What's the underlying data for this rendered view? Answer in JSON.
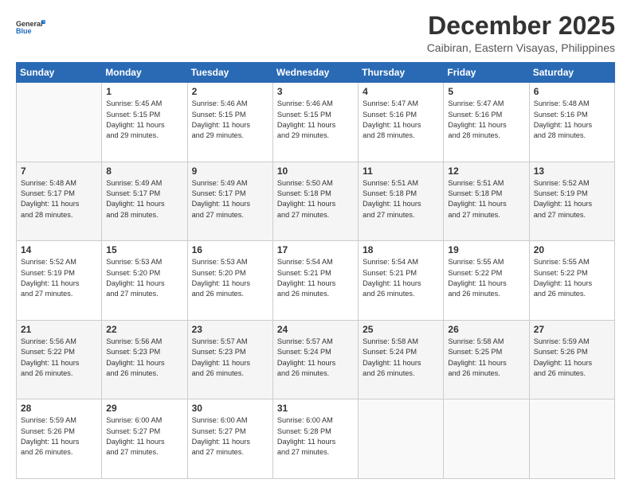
{
  "logo": {
    "line1": "General",
    "line2": "Blue"
  },
  "title": "December 2025",
  "subtitle": "Caibiran, Eastern Visayas, Philippines",
  "weekdays": [
    "Sunday",
    "Monday",
    "Tuesday",
    "Wednesday",
    "Thursday",
    "Friday",
    "Saturday"
  ],
  "weeks": [
    [
      {
        "day": "",
        "info": ""
      },
      {
        "day": "1",
        "info": "Sunrise: 5:45 AM\nSunset: 5:15 PM\nDaylight: 11 hours\nand 29 minutes."
      },
      {
        "day": "2",
        "info": "Sunrise: 5:46 AM\nSunset: 5:15 PM\nDaylight: 11 hours\nand 29 minutes."
      },
      {
        "day": "3",
        "info": "Sunrise: 5:46 AM\nSunset: 5:15 PM\nDaylight: 11 hours\nand 29 minutes."
      },
      {
        "day": "4",
        "info": "Sunrise: 5:47 AM\nSunset: 5:16 PM\nDaylight: 11 hours\nand 28 minutes."
      },
      {
        "day": "5",
        "info": "Sunrise: 5:47 AM\nSunset: 5:16 PM\nDaylight: 11 hours\nand 28 minutes."
      },
      {
        "day": "6",
        "info": "Sunrise: 5:48 AM\nSunset: 5:16 PM\nDaylight: 11 hours\nand 28 minutes."
      }
    ],
    [
      {
        "day": "7",
        "info": "Sunrise: 5:48 AM\nSunset: 5:17 PM\nDaylight: 11 hours\nand 28 minutes."
      },
      {
        "day": "8",
        "info": "Sunrise: 5:49 AM\nSunset: 5:17 PM\nDaylight: 11 hours\nand 28 minutes."
      },
      {
        "day": "9",
        "info": "Sunrise: 5:49 AM\nSunset: 5:17 PM\nDaylight: 11 hours\nand 27 minutes."
      },
      {
        "day": "10",
        "info": "Sunrise: 5:50 AM\nSunset: 5:18 PM\nDaylight: 11 hours\nand 27 minutes."
      },
      {
        "day": "11",
        "info": "Sunrise: 5:51 AM\nSunset: 5:18 PM\nDaylight: 11 hours\nand 27 minutes."
      },
      {
        "day": "12",
        "info": "Sunrise: 5:51 AM\nSunset: 5:18 PM\nDaylight: 11 hours\nand 27 minutes."
      },
      {
        "day": "13",
        "info": "Sunrise: 5:52 AM\nSunset: 5:19 PM\nDaylight: 11 hours\nand 27 minutes."
      }
    ],
    [
      {
        "day": "14",
        "info": "Sunrise: 5:52 AM\nSunset: 5:19 PM\nDaylight: 11 hours\nand 27 minutes."
      },
      {
        "day": "15",
        "info": "Sunrise: 5:53 AM\nSunset: 5:20 PM\nDaylight: 11 hours\nand 27 minutes."
      },
      {
        "day": "16",
        "info": "Sunrise: 5:53 AM\nSunset: 5:20 PM\nDaylight: 11 hours\nand 26 minutes."
      },
      {
        "day": "17",
        "info": "Sunrise: 5:54 AM\nSunset: 5:21 PM\nDaylight: 11 hours\nand 26 minutes."
      },
      {
        "day": "18",
        "info": "Sunrise: 5:54 AM\nSunset: 5:21 PM\nDaylight: 11 hours\nand 26 minutes."
      },
      {
        "day": "19",
        "info": "Sunrise: 5:55 AM\nSunset: 5:22 PM\nDaylight: 11 hours\nand 26 minutes."
      },
      {
        "day": "20",
        "info": "Sunrise: 5:55 AM\nSunset: 5:22 PM\nDaylight: 11 hours\nand 26 minutes."
      }
    ],
    [
      {
        "day": "21",
        "info": "Sunrise: 5:56 AM\nSunset: 5:22 PM\nDaylight: 11 hours\nand 26 minutes."
      },
      {
        "day": "22",
        "info": "Sunrise: 5:56 AM\nSunset: 5:23 PM\nDaylight: 11 hours\nand 26 minutes."
      },
      {
        "day": "23",
        "info": "Sunrise: 5:57 AM\nSunset: 5:23 PM\nDaylight: 11 hours\nand 26 minutes."
      },
      {
        "day": "24",
        "info": "Sunrise: 5:57 AM\nSunset: 5:24 PM\nDaylight: 11 hours\nand 26 minutes."
      },
      {
        "day": "25",
        "info": "Sunrise: 5:58 AM\nSunset: 5:24 PM\nDaylight: 11 hours\nand 26 minutes."
      },
      {
        "day": "26",
        "info": "Sunrise: 5:58 AM\nSunset: 5:25 PM\nDaylight: 11 hours\nand 26 minutes."
      },
      {
        "day": "27",
        "info": "Sunrise: 5:59 AM\nSunset: 5:26 PM\nDaylight: 11 hours\nand 26 minutes."
      }
    ],
    [
      {
        "day": "28",
        "info": "Sunrise: 5:59 AM\nSunset: 5:26 PM\nDaylight: 11 hours\nand 26 minutes."
      },
      {
        "day": "29",
        "info": "Sunrise: 6:00 AM\nSunset: 5:27 PM\nDaylight: 11 hours\nand 27 minutes."
      },
      {
        "day": "30",
        "info": "Sunrise: 6:00 AM\nSunset: 5:27 PM\nDaylight: 11 hours\nand 27 minutes."
      },
      {
        "day": "31",
        "info": "Sunrise: 6:00 AM\nSunset: 5:28 PM\nDaylight: 11 hours\nand 27 minutes."
      },
      {
        "day": "",
        "info": ""
      },
      {
        "day": "",
        "info": ""
      },
      {
        "day": "",
        "info": ""
      }
    ]
  ]
}
